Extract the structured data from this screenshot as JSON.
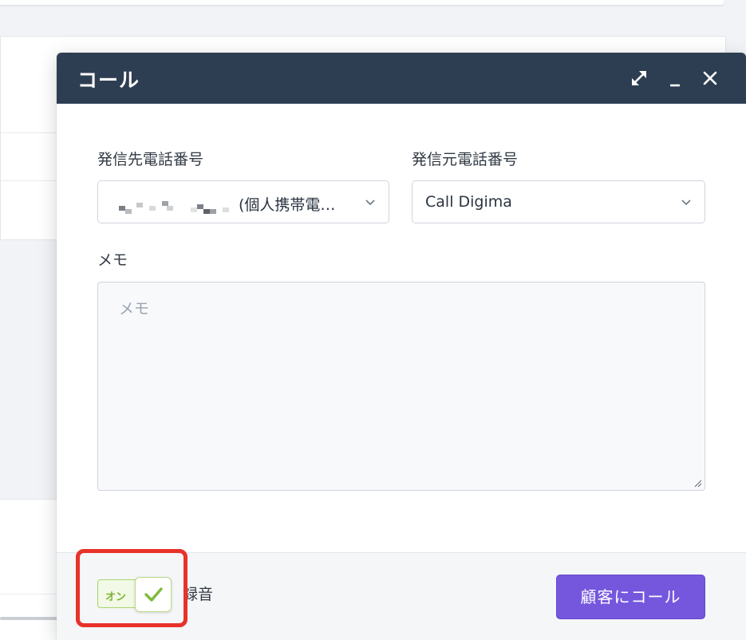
{
  "dialog": {
    "title": "コール",
    "expand_icon": "expand-icon",
    "minimize_icon": "minimize-icon",
    "close_icon": "close-icon"
  },
  "form": {
    "to_label": "発信先電話番号",
    "to_value_suffix": "(個人携帯電…",
    "from_label": "発信元電話番号",
    "from_value": "Call Digima",
    "memo_label": "メモ",
    "memo_placeholder": "メモ"
  },
  "footer": {
    "record_toggle_text": "オン",
    "record_label": "録音",
    "call_button_label": "顧客にコール"
  },
  "colors": {
    "header_bg": "#2e3e52",
    "primary": "#7557de",
    "toggle_on": "#79b432",
    "highlight": "#e8322a"
  }
}
